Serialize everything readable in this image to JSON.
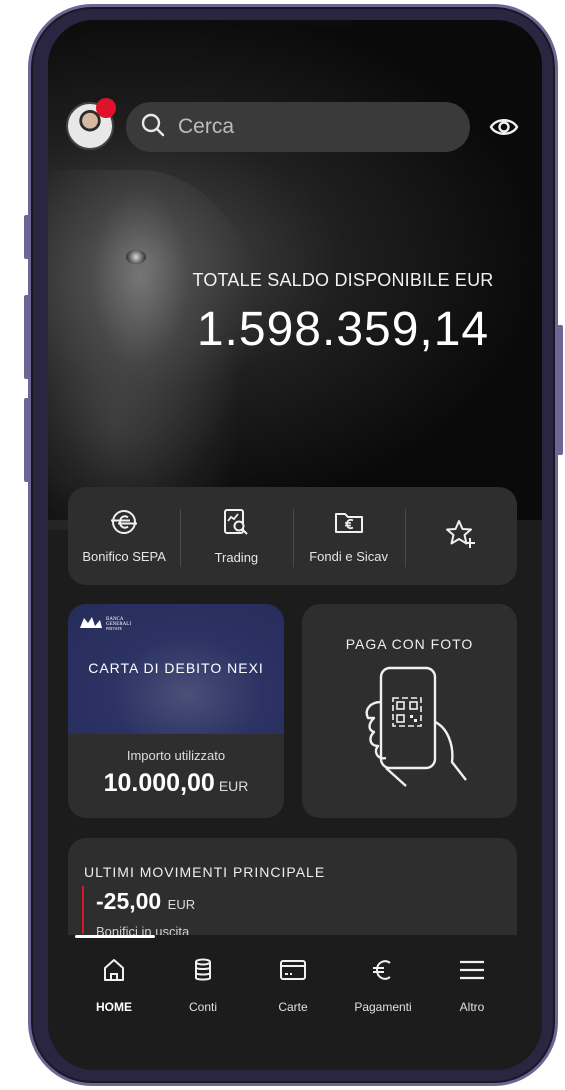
{
  "header": {
    "search_placeholder": "Cerca"
  },
  "balance": {
    "label": "TOTALE SALDO DISPONIBILE EUR",
    "value": "1.598.359,14"
  },
  "quick_actions": [
    {
      "label": "Bonifico SEPA",
      "icon": "euro-transfer-icon"
    },
    {
      "label": "Trading",
      "icon": "chart-search-icon"
    },
    {
      "label": "Fondi e Sicav",
      "icon": "euro-folder-icon"
    },
    {
      "label": "",
      "icon": "star-add-icon"
    }
  ],
  "debit_card": {
    "title": "CARTA DI DEBITO NEXI",
    "bank_logo_line1": "BANCA",
    "bank_logo_line2": "GENERALI",
    "bank_logo_line3": "PRIVATE",
    "used_label": "Importo utilizzato",
    "used_value": "10.000,00",
    "used_currency": "EUR"
  },
  "pay_with_photo": {
    "title": "PAGA CON FOTO"
  },
  "movements": {
    "title": "ULTIMI MOVIMENTI PRINCIPALE",
    "amount": "-25,00",
    "currency": "EUR",
    "description": "Bonifici in uscita",
    "accent_color": "#d01a2b"
  },
  "tabs": [
    {
      "label": "HOME",
      "icon": "home-icon",
      "active": true
    },
    {
      "label": "Conti",
      "icon": "database-icon",
      "active": false
    },
    {
      "label": "Carte",
      "icon": "card-icon",
      "active": false
    },
    {
      "label": "Pagamenti",
      "icon": "euro-icon",
      "active": false
    },
    {
      "label": "Altro",
      "icon": "menu-icon",
      "active": false
    }
  ],
  "colors": {
    "background": "#1c1c1c",
    "panel": "#2e2e2e",
    "notification": "#e0112b",
    "card_blue": "#2c3263"
  }
}
